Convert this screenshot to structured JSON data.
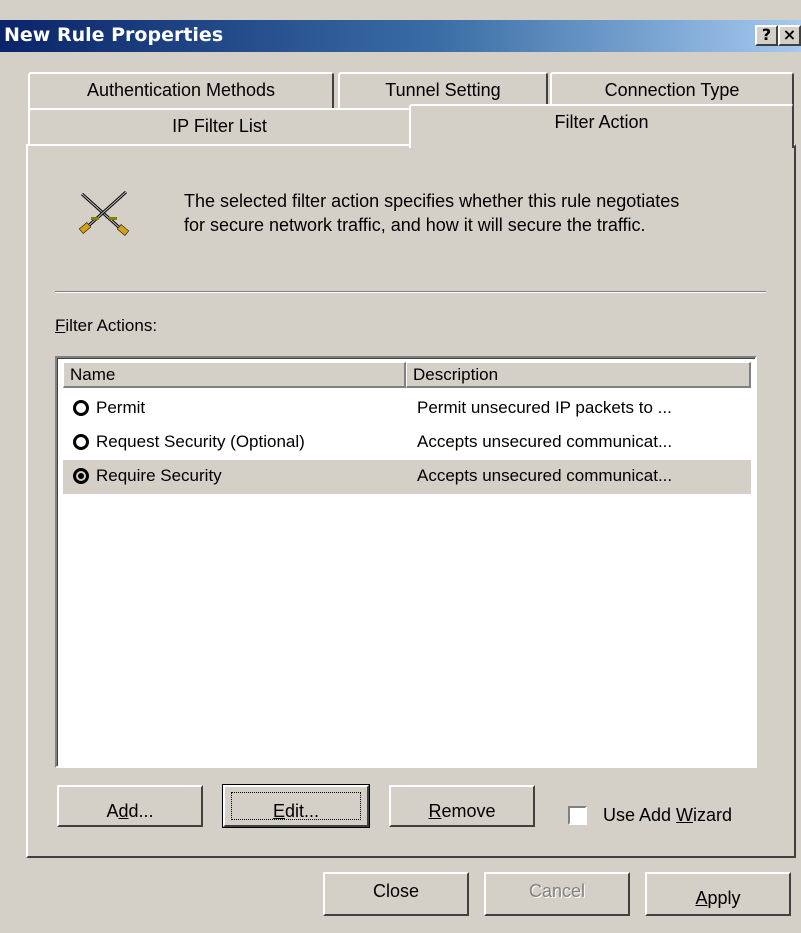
{
  "window": {
    "title": "New Rule Properties",
    "help_glyph": "?",
    "close_glyph": "×"
  },
  "tabs": {
    "authentication_methods": "Authentication Methods",
    "tunnel_setting": "Tunnel Setting",
    "connection_type": "Connection Type",
    "ip_filter_list": "IP Filter List",
    "filter_action": "Filter Action",
    "active": "Filter Action"
  },
  "panel": {
    "icon": "crossed-swords-icon",
    "description_line1": "The selected filter action specifies whether this rule negotiates",
    "description_line2": "for secure network traffic, and how it will secure the traffic.",
    "filter_actions_label_rest": "ilter Actions:",
    "filter_actions_label_accel": "F"
  },
  "list": {
    "columns": [
      "Name",
      "Description"
    ],
    "rows": [
      {
        "name": "Permit",
        "description": "Permit unsecured IP packets to ...",
        "selected": false
      },
      {
        "name": "Request Security (Optional)",
        "description": "Accepts unsecured communicat...",
        "selected": false
      },
      {
        "name": "Require Security",
        "description": "Accepts unsecured communicat...",
        "selected": true
      }
    ]
  },
  "buttons": {
    "add_pre": "A",
    "add_accel": "d",
    "add_post": "d...",
    "edit_accel": "E",
    "edit_post": "dit...",
    "remove_accel": "R",
    "remove_post": "emove",
    "use_add_wizard_pre": "Use Add ",
    "use_add_wizard_accel": "W",
    "use_add_wizard_post": "izard",
    "use_add_wizard_checked": false,
    "close": "Close",
    "cancel": "Cancel",
    "apply_accel": "A",
    "apply_post": "pply"
  },
  "colors": {
    "face": "#d4d0c8",
    "title_start": "#0a246a",
    "title_end": "#a6caf0"
  }
}
